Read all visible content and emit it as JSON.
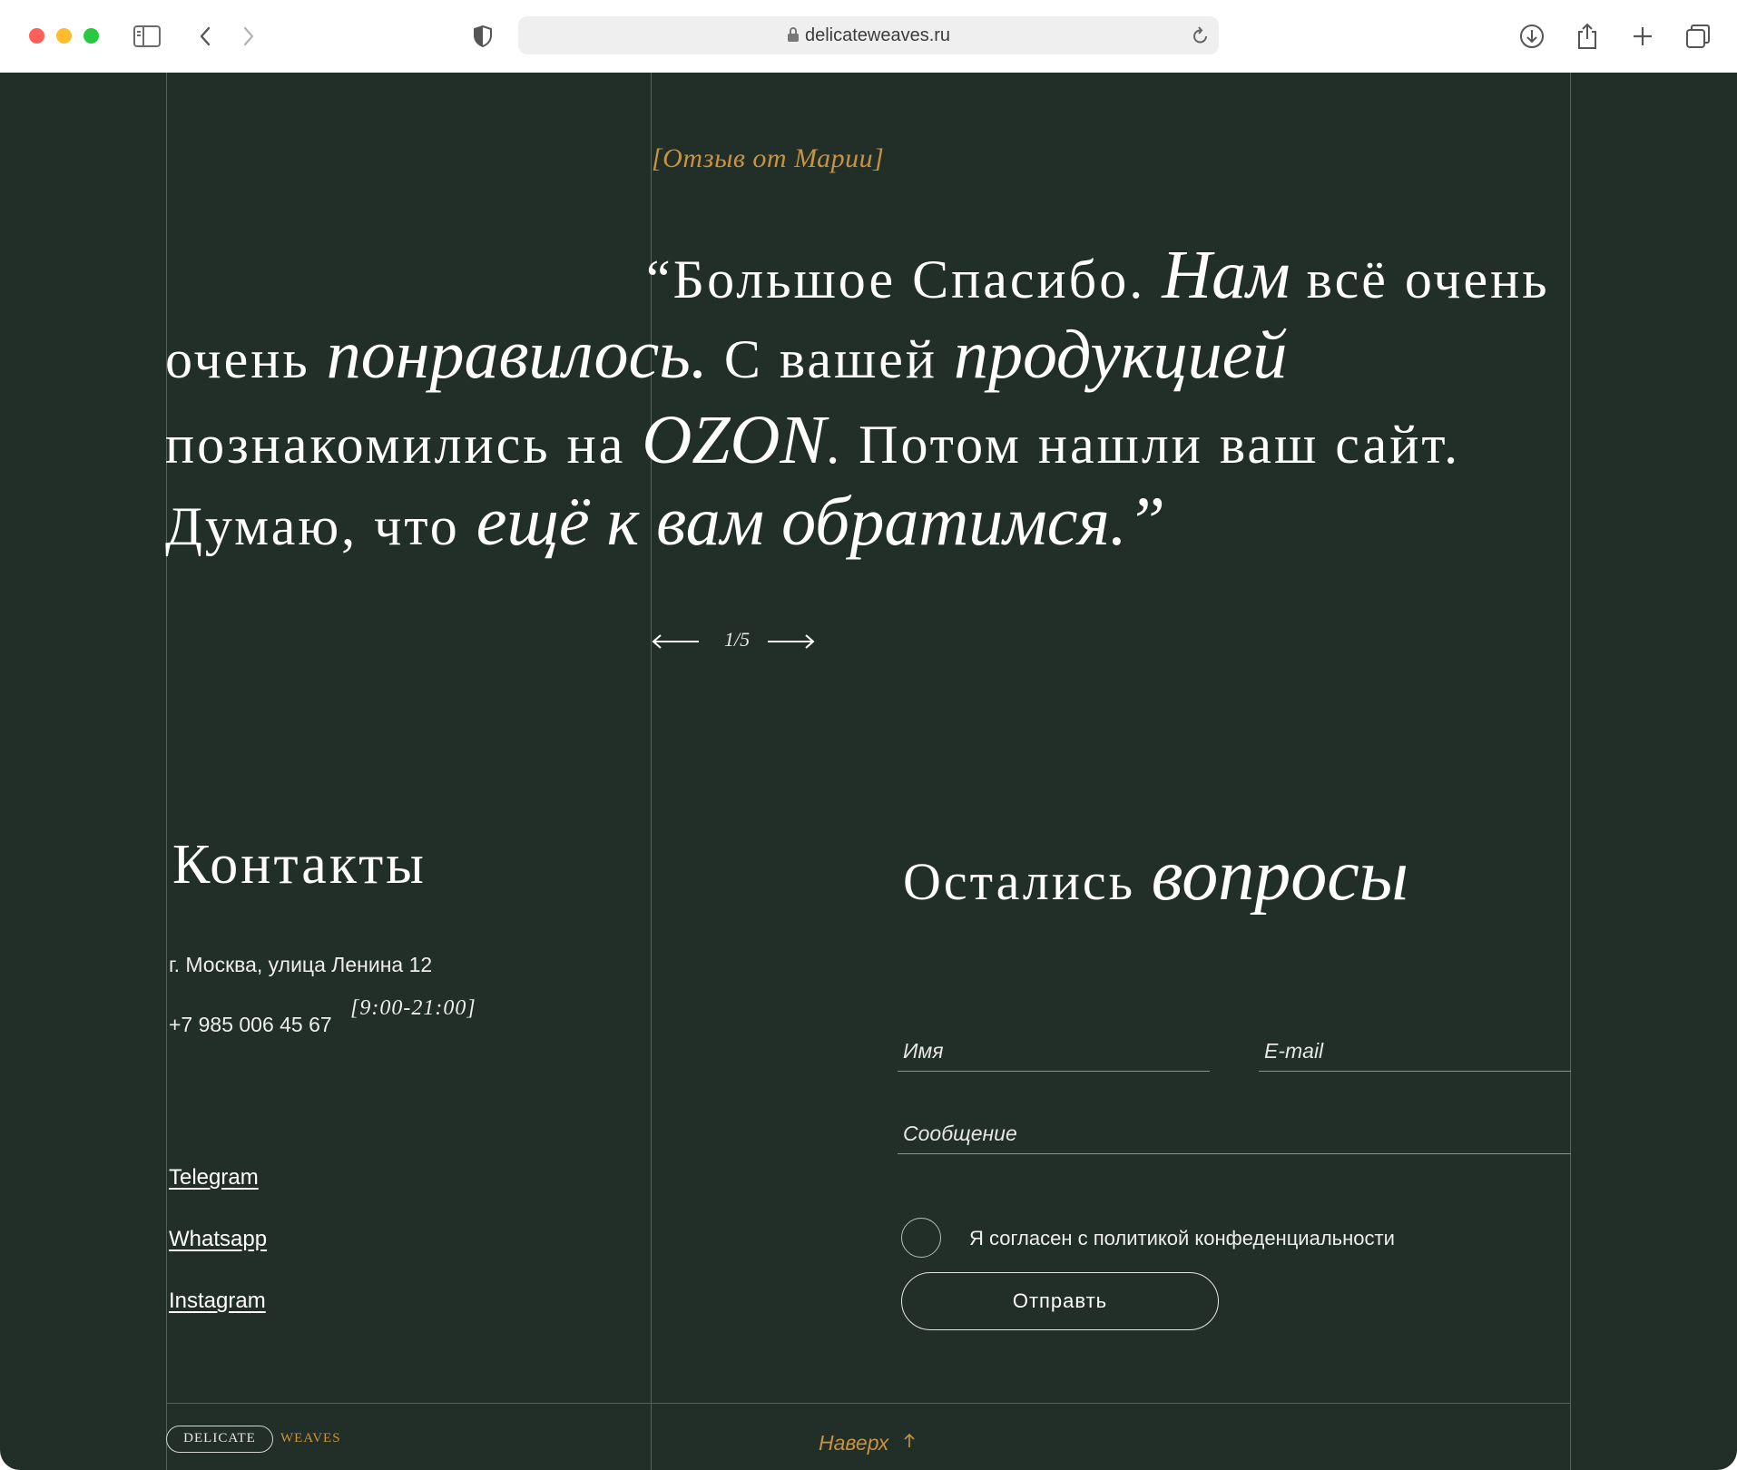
{
  "browser": {
    "url": "delicateweaves.ru"
  },
  "review": {
    "author": "[Отзыв от Марии]",
    "lines": [
      {
        "a": "“Большое Спасибо. ",
        "b": "Нам",
        "c": " всё очень"
      },
      {
        "a": "очень ",
        "b": "понравилось.",
        "c": " С  вашей ",
        "d": "продукцией"
      },
      {
        "a": "познакомились на ",
        "b": "OZON",
        "c": ".  Потом нашли ваш сайт."
      },
      {
        "a": "Думаю, что ",
        "b": "ещё к вам обратимся.”"
      }
    ],
    "counter": "1/5"
  },
  "contacts": {
    "title": "Контакты",
    "address": "г. Москва, улица Ленина 12",
    "phone": "+7 985 006 45 67",
    "hours": "[9:00-21:00]",
    "social": [
      "Telegram",
      "Whatsapp",
      "Instagram"
    ]
  },
  "form": {
    "title_regular": "Остались ",
    "title_italic": "вопросы",
    "name_placeholder": "Имя",
    "email_placeholder": "E-mail",
    "message_placeholder": "Сообщение",
    "consent": "Я согласен с политикой конфеденциальности",
    "submit": "Отправть"
  },
  "footer": {
    "logo_left": "DELICATE",
    "logo_right": "WEAVES",
    "to_top": "Наверх"
  },
  "colors": {
    "background": "#222f29",
    "accent": "#c9923f",
    "lines": "#56645c"
  }
}
